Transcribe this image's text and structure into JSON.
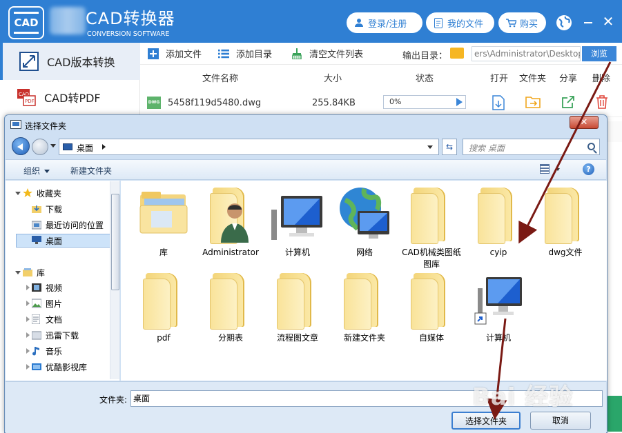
{
  "app": {
    "title": "CAD转换器",
    "subtitle": "CONVERSION SOFTWARE",
    "logo_text": "CAD",
    "header_buttons": {
      "login": "登录/注册",
      "my_files": "我的文件",
      "buy": "购买"
    }
  },
  "sidebar": {
    "items": [
      {
        "label": "CAD版本转换",
        "icon": "version-convert-icon",
        "active": true
      },
      {
        "label": "CAD转PDF",
        "icon": "cad-to-pdf-icon",
        "active": false
      }
    ]
  },
  "toolbar": {
    "add_file": "添加文件",
    "add_dir": "添加目录",
    "clear_list": "清空文件列表",
    "output_label": "输出目录：",
    "output_path": "ers\\Administrator\\Desktop",
    "browse": "浏览"
  },
  "table": {
    "headers": {
      "name": "文件名称",
      "size": "大小",
      "status": "状态",
      "open": "打开",
      "folder": "文件夹",
      "share": "分享",
      "delete": "删除"
    },
    "rows": [
      {
        "type_badge": "DWG",
        "name": "5458f119d5480.dwg",
        "size": "255.84KB",
        "progress_text": "0%",
        "progress": 0
      }
    ]
  },
  "dialog": {
    "title": "选择文件夹",
    "address": "桌面",
    "search_placeholder": "搜索 桌面",
    "commands": {
      "organize": "组织",
      "new_folder": "新建文件夹"
    },
    "nav": {
      "favorites": "收藏夹",
      "downloads": "下载",
      "recent": "最近访问的位置",
      "desktop": "桌面",
      "libraries": "库",
      "videos": "视频",
      "pictures": "图片",
      "documents": "文档",
      "xunlei": "迅雷下载",
      "music": "音乐",
      "youku": "优酷影视库"
    },
    "items": [
      {
        "label": "库",
        "icon": "library-folder-icon"
      },
      {
        "label": "Administrator",
        "icon": "user-folder-icon"
      },
      {
        "label": "计算机",
        "icon": "computer-icon"
      },
      {
        "label": "网络",
        "icon": "network-icon"
      },
      {
        "label": "CAD机械类图纸图库",
        "icon": "folder-icon"
      },
      {
        "label": "cyip",
        "icon": "folder-icon"
      },
      {
        "label": "dwg文件",
        "icon": "folder-icon"
      },
      {
        "label": "pdf",
        "icon": "folder-icon"
      },
      {
        "label": "分期表",
        "icon": "folder-icon"
      },
      {
        "label": "流程图文章",
        "icon": "folder-icon"
      },
      {
        "label": "新建文件夹",
        "icon": "folder-icon"
      },
      {
        "label": "自媒体",
        "icon": "folder-icon"
      },
      {
        "label": "计算机",
        "icon": "computer-shortcut-icon"
      }
    ],
    "filename_label": "文件夹:",
    "filename_value": "桌面",
    "ok_button": "选择文件夹",
    "cancel_button": "取消"
  },
  "watermark": "Bai 经验",
  "colors": {
    "brand_blue": "#2f7fd3",
    "annotation_arrow": "#7a1a14",
    "dialog_frame": "#cfe0f3"
  }
}
